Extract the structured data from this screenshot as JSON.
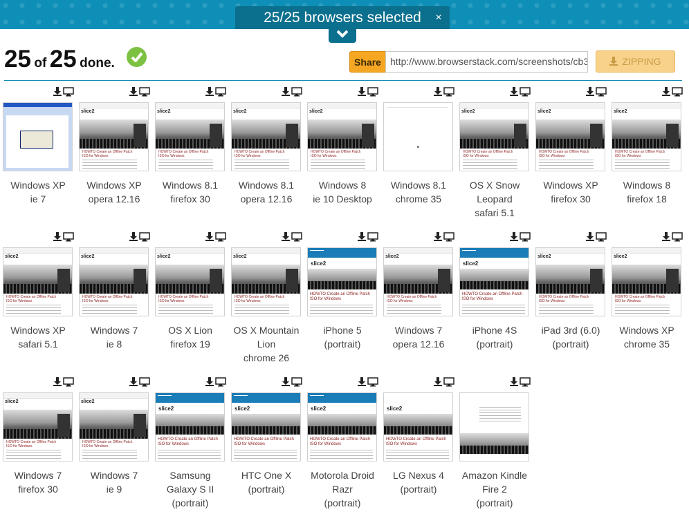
{
  "banner": {
    "selected_text": "25/25 browsers selected",
    "close_glyph": "×"
  },
  "status": {
    "done_count": "25",
    "of_word": "of",
    "total": "25",
    "done_word": "done."
  },
  "share": {
    "label": "Share",
    "url": "http://www.browserstack.com/screenshots/cb3"
  },
  "zip": {
    "label": "ZIPPING"
  },
  "thumb_text": {
    "logo": "slice2",
    "post_title": "HOWTO Create an Offline Patch ISO for Windows",
    "menu": "Menu ▾"
  },
  "tiles": [
    {
      "line1": "Windows XP",
      "line2": "ie 7",
      "line3": "",
      "kind": "xp"
    },
    {
      "line1": "Windows XP",
      "line2": "opera 12.16",
      "line3": "",
      "kind": "desktop"
    },
    {
      "line1": "Windows 8.1",
      "line2": "firefox 30",
      "line3": "",
      "kind": "desktop"
    },
    {
      "line1": "Windows 8.1",
      "line2": "opera 12.16",
      "line3": "",
      "kind": "desktop"
    },
    {
      "line1": "Windows 8",
      "line2": "ie 10 Desktop",
      "line3": "",
      "kind": "desktop"
    },
    {
      "line1": "Windows 8.1",
      "line2": "chrome 35",
      "line3": "",
      "kind": "blank"
    },
    {
      "line1": "OS X Snow",
      "line2": "Leopard",
      "line3": "safari 5.1",
      "kind": "desktop"
    },
    {
      "line1": "Windows XP",
      "line2": "firefox 30",
      "line3": "",
      "kind": "desktop"
    },
    {
      "line1": "Windows 8",
      "line2": "firefox 18",
      "line3": "",
      "kind": "desktop"
    },
    {
      "line1": "Windows XP",
      "line2": "safari 5.1",
      "line3": "",
      "kind": "desktop"
    },
    {
      "line1": "Windows 7",
      "line2": "ie 8",
      "line3": "",
      "kind": "desktop"
    },
    {
      "line1": "OS X Lion",
      "line2": "firefox 19",
      "line3": "",
      "kind": "desktop"
    },
    {
      "line1": "OS X Mountain",
      "line2": "Lion",
      "line3": "chrome 26",
      "kind": "desktop"
    },
    {
      "line1": "iPhone 5",
      "line2": "(portrait)",
      "line3": "",
      "kind": "mobile"
    },
    {
      "line1": "Windows 7",
      "line2": "opera 12.16",
      "line3": "",
      "kind": "desktop"
    },
    {
      "line1": "iPhone 4S",
      "line2": "(portrait)",
      "line3": "",
      "kind": "mobile"
    },
    {
      "line1": "iPad 3rd (6.0)",
      "line2": "(portrait)",
      "line3": "",
      "kind": "desktop"
    },
    {
      "line1": "Windows XP",
      "line2": "chrome 35",
      "line3": "",
      "kind": "desktop"
    },
    {
      "line1": "Windows 7",
      "line2": "firefox 30",
      "line3": "",
      "kind": "desktop"
    },
    {
      "line1": "Windows 7",
      "line2": "ie 9",
      "line3": "",
      "kind": "desktop"
    },
    {
      "line1": "Samsung",
      "line2": "Galaxy S II",
      "line3": "(portrait)",
      "kind": "mobile"
    },
    {
      "line1": "HTC One X",
      "line2": "(portrait)",
      "line3": "",
      "kind": "mobile"
    },
    {
      "line1": "Motorola Droid",
      "line2": "Razr",
      "line3": "(portrait)",
      "kind": "mobile"
    },
    {
      "line1": "LG Nexus 4",
      "line2": "(portrait)",
      "line3": "",
      "kind": "mobile-white"
    },
    {
      "line1": "Amazon Kindle",
      "line2": "Fire 2",
      "line3": "(portrait)",
      "kind": "kindle"
    }
  ],
  "icons": {
    "download": "download-icon",
    "desktop": "monitor-icon",
    "check": "check-circle-icon",
    "chevron": "chevron-down-icon"
  },
  "colors": {
    "banner": "#0e8fb8",
    "banner_dark": "#0b6f8e",
    "share": "#f5a623",
    "zip": "#f8d28a",
    "check": "#7cc142",
    "mobile_bar": "#1a7db7"
  }
}
